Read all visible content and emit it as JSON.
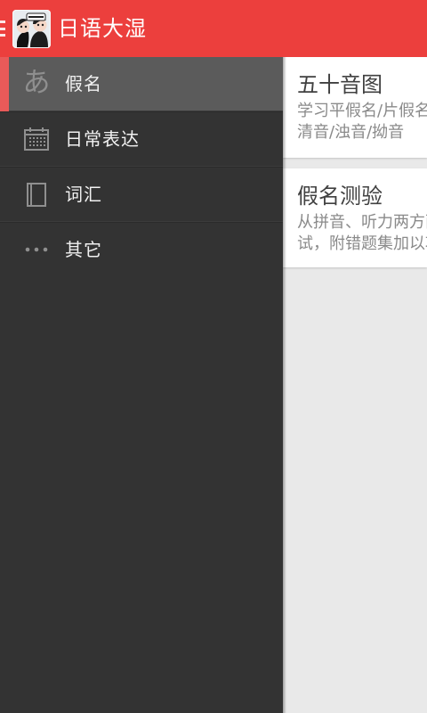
{
  "app": {
    "title": "日语大湿"
  },
  "drawer": {
    "items": [
      {
        "label": "假名",
        "icon": "hiragana-a-icon",
        "icon_text": "あ",
        "active": true
      },
      {
        "label": "日常表达",
        "icon": "calendar-icon",
        "active": false
      },
      {
        "label": "词汇",
        "icon": "notebook-icon",
        "active": false
      },
      {
        "label": "其它",
        "icon": "more-dots-icon",
        "active": false
      }
    ]
  },
  "content": {
    "cards": [
      {
        "title": "五十音图",
        "desc": "学习平假名/片假名，切换清音/浊音/拗音"
      },
      {
        "title": "假名测验",
        "desc": "从拼音、听力两方面测试，附错题集加以巩固"
      }
    ]
  },
  "colors": {
    "app_bar": "#ec3f3d",
    "drawer_background": "#333333",
    "drawer_active_background": "#5b5b5b",
    "active_indicator": "#e95a59",
    "content_background": "#e9e9e9"
  }
}
